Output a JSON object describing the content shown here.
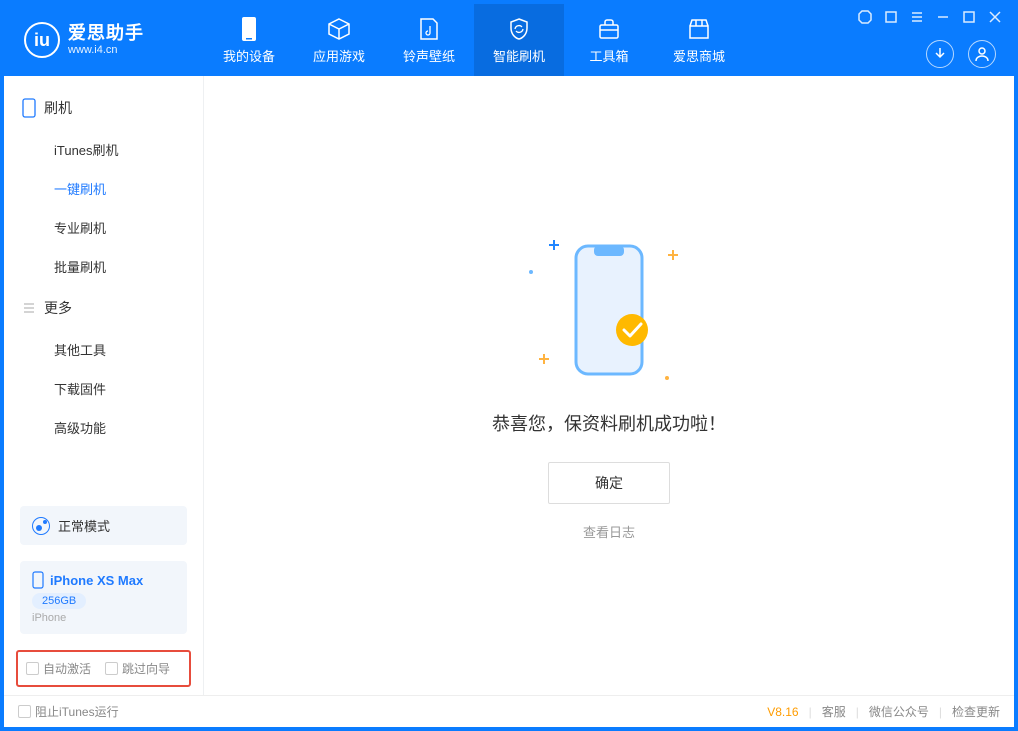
{
  "app": {
    "title": "爱思助手",
    "subtitle": "www.i4.cn"
  },
  "nav": {
    "my_device": "我的设备",
    "apps_games": "应用游戏",
    "ringtones": "铃声壁纸",
    "smart_flash": "智能刷机",
    "toolbox": "工具箱",
    "store": "爱思商城"
  },
  "sidebar": {
    "section_flash": "刷机",
    "itunes_flash": "iTunes刷机",
    "one_click_flash": "一键刷机",
    "pro_flash": "专业刷机",
    "batch_flash": "批量刷机",
    "section_more": "更多",
    "other_tools": "其他工具",
    "download_fw": "下载固件",
    "advanced": "高级功能"
  },
  "device": {
    "mode_label": "正常模式",
    "name": "iPhone XS Max",
    "storage": "256GB",
    "type": "iPhone"
  },
  "options": {
    "auto_activate": "自动激活",
    "skip_guide": "跳过向导"
  },
  "main": {
    "success_text": "恭喜您，保资料刷机成功啦！",
    "ok_button": "确定",
    "view_log": "查看日志"
  },
  "footer": {
    "block_itunes": "阻止iTunes运行",
    "version": "V8.16",
    "support": "客服",
    "wechat": "微信公众号",
    "check_update": "检查更新"
  }
}
